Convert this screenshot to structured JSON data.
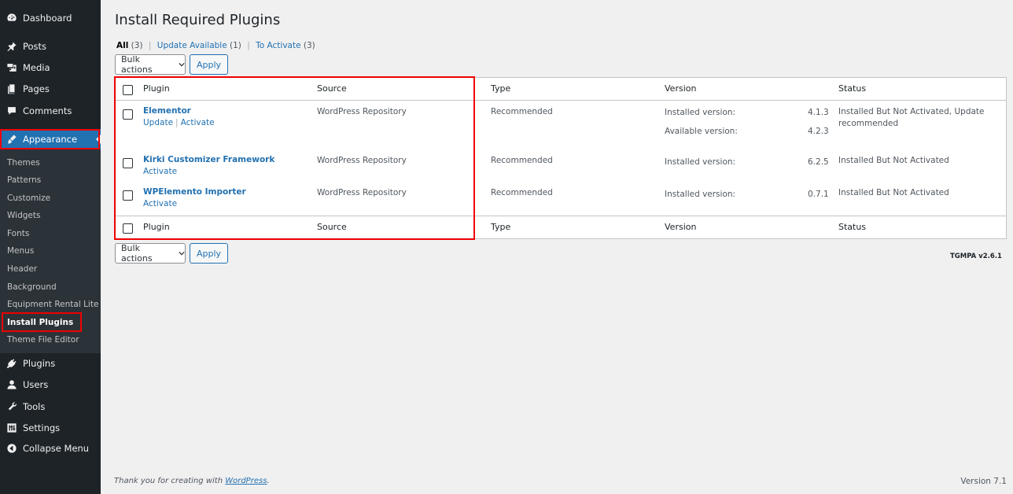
{
  "sidebar": {
    "top_items": [
      {
        "label": "Dashboard",
        "icon": "dashboard-icon"
      },
      {
        "label": "Posts",
        "icon": "pin-icon"
      },
      {
        "label": "Media",
        "icon": "media-icon"
      },
      {
        "label": "Pages",
        "icon": "pages-icon"
      },
      {
        "label": "Comments",
        "icon": "comment-icon"
      },
      {
        "label": "Appearance",
        "icon": "brush-icon"
      }
    ],
    "submenu": [
      "Themes",
      "Patterns",
      "Customize",
      "Widgets",
      "Fonts",
      "Menus",
      "Header",
      "Background",
      "Equipment Rental Lite",
      "Install Plugins",
      "Theme File Editor"
    ],
    "bottom_items": [
      {
        "label": "Plugins",
        "icon": "plug-icon"
      },
      {
        "label": "Users",
        "icon": "user-icon"
      },
      {
        "label": "Tools",
        "icon": "wrench-icon"
      },
      {
        "label": "Settings",
        "icon": "settings-icon"
      },
      {
        "label": "Collapse Menu",
        "icon": "collapse-icon"
      }
    ]
  },
  "page": {
    "title": "Install Required Plugins",
    "filters": {
      "all_label": "All",
      "all_count": "(3)",
      "update_label": "Update Available",
      "update_count": "(1)",
      "activate_label": "To Activate",
      "activate_count": "(3)",
      "separator": "|"
    },
    "bulk_actions_label": "Bulk actions",
    "apply_label": "Apply"
  },
  "table": {
    "columns": {
      "plugin": "Plugin",
      "source": "Source",
      "type": "Type",
      "version": "Version",
      "status": "Status"
    },
    "rows": [
      {
        "name": "Elementor",
        "actions": [
          "Update",
          "Activate"
        ],
        "source": "WordPress Repository",
        "type": "Recommended",
        "installed_label": "Installed version:",
        "installed_value": "4.1.3",
        "available_label": "Available version:",
        "available_value": "4.2.3",
        "status": "Installed But Not Activated, Update recommended"
      },
      {
        "name": "Kirki Customizer Framework",
        "actions": [
          "Activate"
        ],
        "source": "WordPress Repository",
        "type": "Recommended",
        "installed_label": "Installed version:",
        "installed_value": "6.2.5",
        "status": "Installed But Not Activated"
      },
      {
        "name": "WPElemento Importer",
        "actions": [
          "Activate"
        ],
        "source": "WordPress Repository",
        "type": "Recommended",
        "installed_label": "Installed version:",
        "installed_value": "0.7.1",
        "status": "Installed But Not Activated"
      }
    ]
  },
  "tgmpa_version": "TGMPA v2.6.1",
  "footer": {
    "thanks_prefix": "Thank you for creating with ",
    "wordpress_link": "WordPress",
    "thanks_suffix": ".",
    "version": "Version 7.1"
  },
  "colors": {
    "sidebar_bg": "#1d2327",
    "accent": "#2271b1",
    "highlight_box": "#e00000"
  }
}
